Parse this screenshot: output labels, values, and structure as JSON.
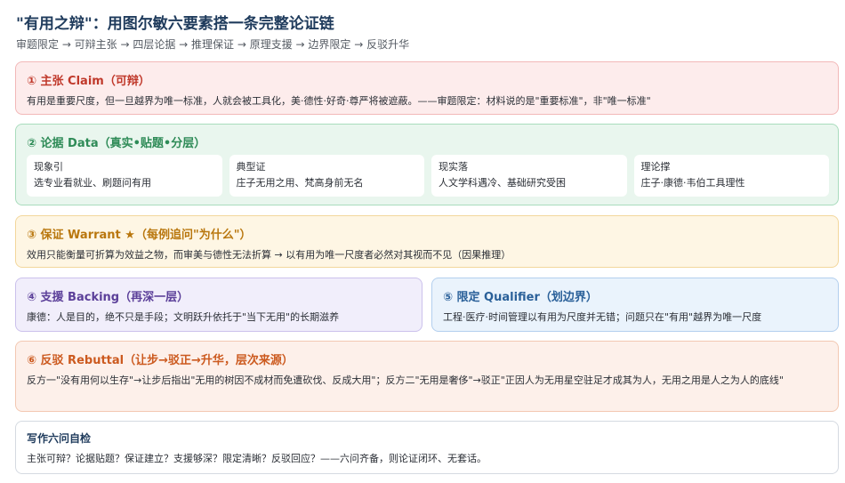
{
  "header": {
    "title": "\"有用之辩\"：用图尔敏六要素搭一条完整论证链",
    "subtitle": "审题限定 → 可辩主张 → 四层论据 → 推理保证 → 原理支援 → 边界限定 → 反驳升华"
  },
  "claim": {
    "heading": "① 主张 Claim（可辩）",
    "body": "有用是重要尺度，但一旦越界为唯一标准，人就会被工具化，美·德性·好奇·尊严将被遮蔽。——审题限定：材料说的是\"重要标准\"，非\"唯一标准\""
  },
  "data": {
    "heading": "② 论据 Data（真实•贴题•分层）",
    "items": [
      {
        "label": "现象引",
        "text": "选专业看就业、刷题问有用"
      },
      {
        "label": "典型证",
        "text": "庄子无用之用、梵高身前无名"
      },
      {
        "label": "现实落",
        "text": "人文学科遇冷、基础研究受困"
      },
      {
        "label": "理论撑",
        "text": "庄子·康德·韦伯工具理性"
      }
    ]
  },
  "warrant": {
    "heading": "③ 保证 Warrant ★（每例追问\"为什么\"）",
    "body": "效用只能衡量可折算为效益之物，而审美与德性无法折算 → 以有用为唯一尺度者必然对其视而不见（因果推理）"
  },
  "backing": {
    "heading": "④ 支援 Backing（再深一层）",
    "body": "康德：人是目的，绝不只是手段；文明跃升依托于\"当下无用\"的长期滋养"
  },
  "qualifier": {
    "heading": "⑤ 限定 Qualifier（划边界）",
    "body": "工程·医疗·时间管理以有用为尺度并无错；问题只在\"有用\"越界为唯一尺度"
  },
  "rebuttal": {
    "heading": "⑥ 反驳 Rebuttal（让步→驳正→升华，层次来源）",
    "body": "反方一\"没有用何以生存\"→让步后指出\"无用的树因不成材而免遭砍伐、反成大用\"；反方二\"无用是奢侈\"→驳正\"正因人为无用星空驻足才成其为人，无用之用是人之为人的底线\""
  },
  "check": {
    "heading": "写作六问自检",
    "body": "主张可辩？论据贴题？保证建立？支援够深？限定清晰？反驳回应？——六问齐备，则论证闭环、无套话。"
  }
}
